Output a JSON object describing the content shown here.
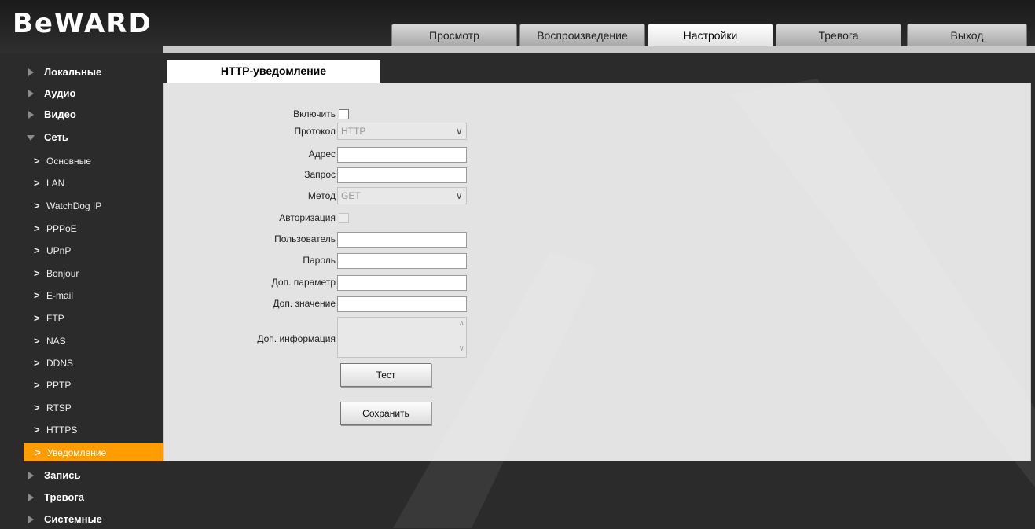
{
  "brand": "BeWARD",
  "tabs": [
    {
      "label": "Просмотр"
    },
    {
      "label": "Воспроизведение"
    },
    {
      "label": "Настройки"
    },
    {
      "label": "Тревога"
    },
    {
      "label": "Выход"
    }
  ],
  "active_tab": "Настройки",
  "sidebar": {
    "items": [
      {
        "label": "Локальные"
      },
      {
        "label": "Аудио"
      },
      {
        "label": "Видео"
      },
      {
        "label": "Сеть"
      }
    ],
    "network_sub": [
      {
        "label": "Основные"
      },
      {
        "label": "LAN"
      },
      {
        "label": "WatchDog IP"
      },
      {
        "label": "PPPoE"
      },
      {
        "label": "UPnP"
      },
      {
        "label": "Bonjour"
      },
      {
        "label": "E-mail"
      },
      {
        "label": "FTP"
      },
      {
        "label": "NAS"
      },
      {
        "label": "DDNS"
      },
      {
        "label": "PPTP"
      },
      {
        "label": "RTSP"
      },
      {
        "label": "HTTPS"
      },
      {
        "label": "Уведомление"
      }
    ],
    "after": [
      {
        "label": "Запись"
      },
      {
        "label": "Тревога"
      },
      {
        "label": "Системные"
      }
    ]
  },
  "content": {
    "tab": "HTTP-уведомление",
    "form": {
      "enable_label": "Включить",
      "protocol_label": "Протокол",
      "protocol_value": "HTTP",
      "address_label": "Адрес",
      "address_value": "",
      "request_label": "Запрос",
      "request_value": "",
      "method_label": "Метод",
      "method_value": "GET",
      "auth_label": "Авторизация",
      "user_label": "Пользователь",
      "user_value": "",
      "password_label": "Пароль",
      "password_value": "",
      "extra_param_label": "Доп. параметр",
      "extra_param_value": "",
      "extra_value_label": "Доп. значение",
      "extra_value_value": "",
      "extra_info_label": "Доп. информация",
      "test_button": "Тест",
      "save_button": "Сохранить"
    }
  },
  "colors": {
    "accent": "#ff9c00",
    "panel_bg": "#e3e3e3",
    "background": "#2b2b2b"
  }
}
